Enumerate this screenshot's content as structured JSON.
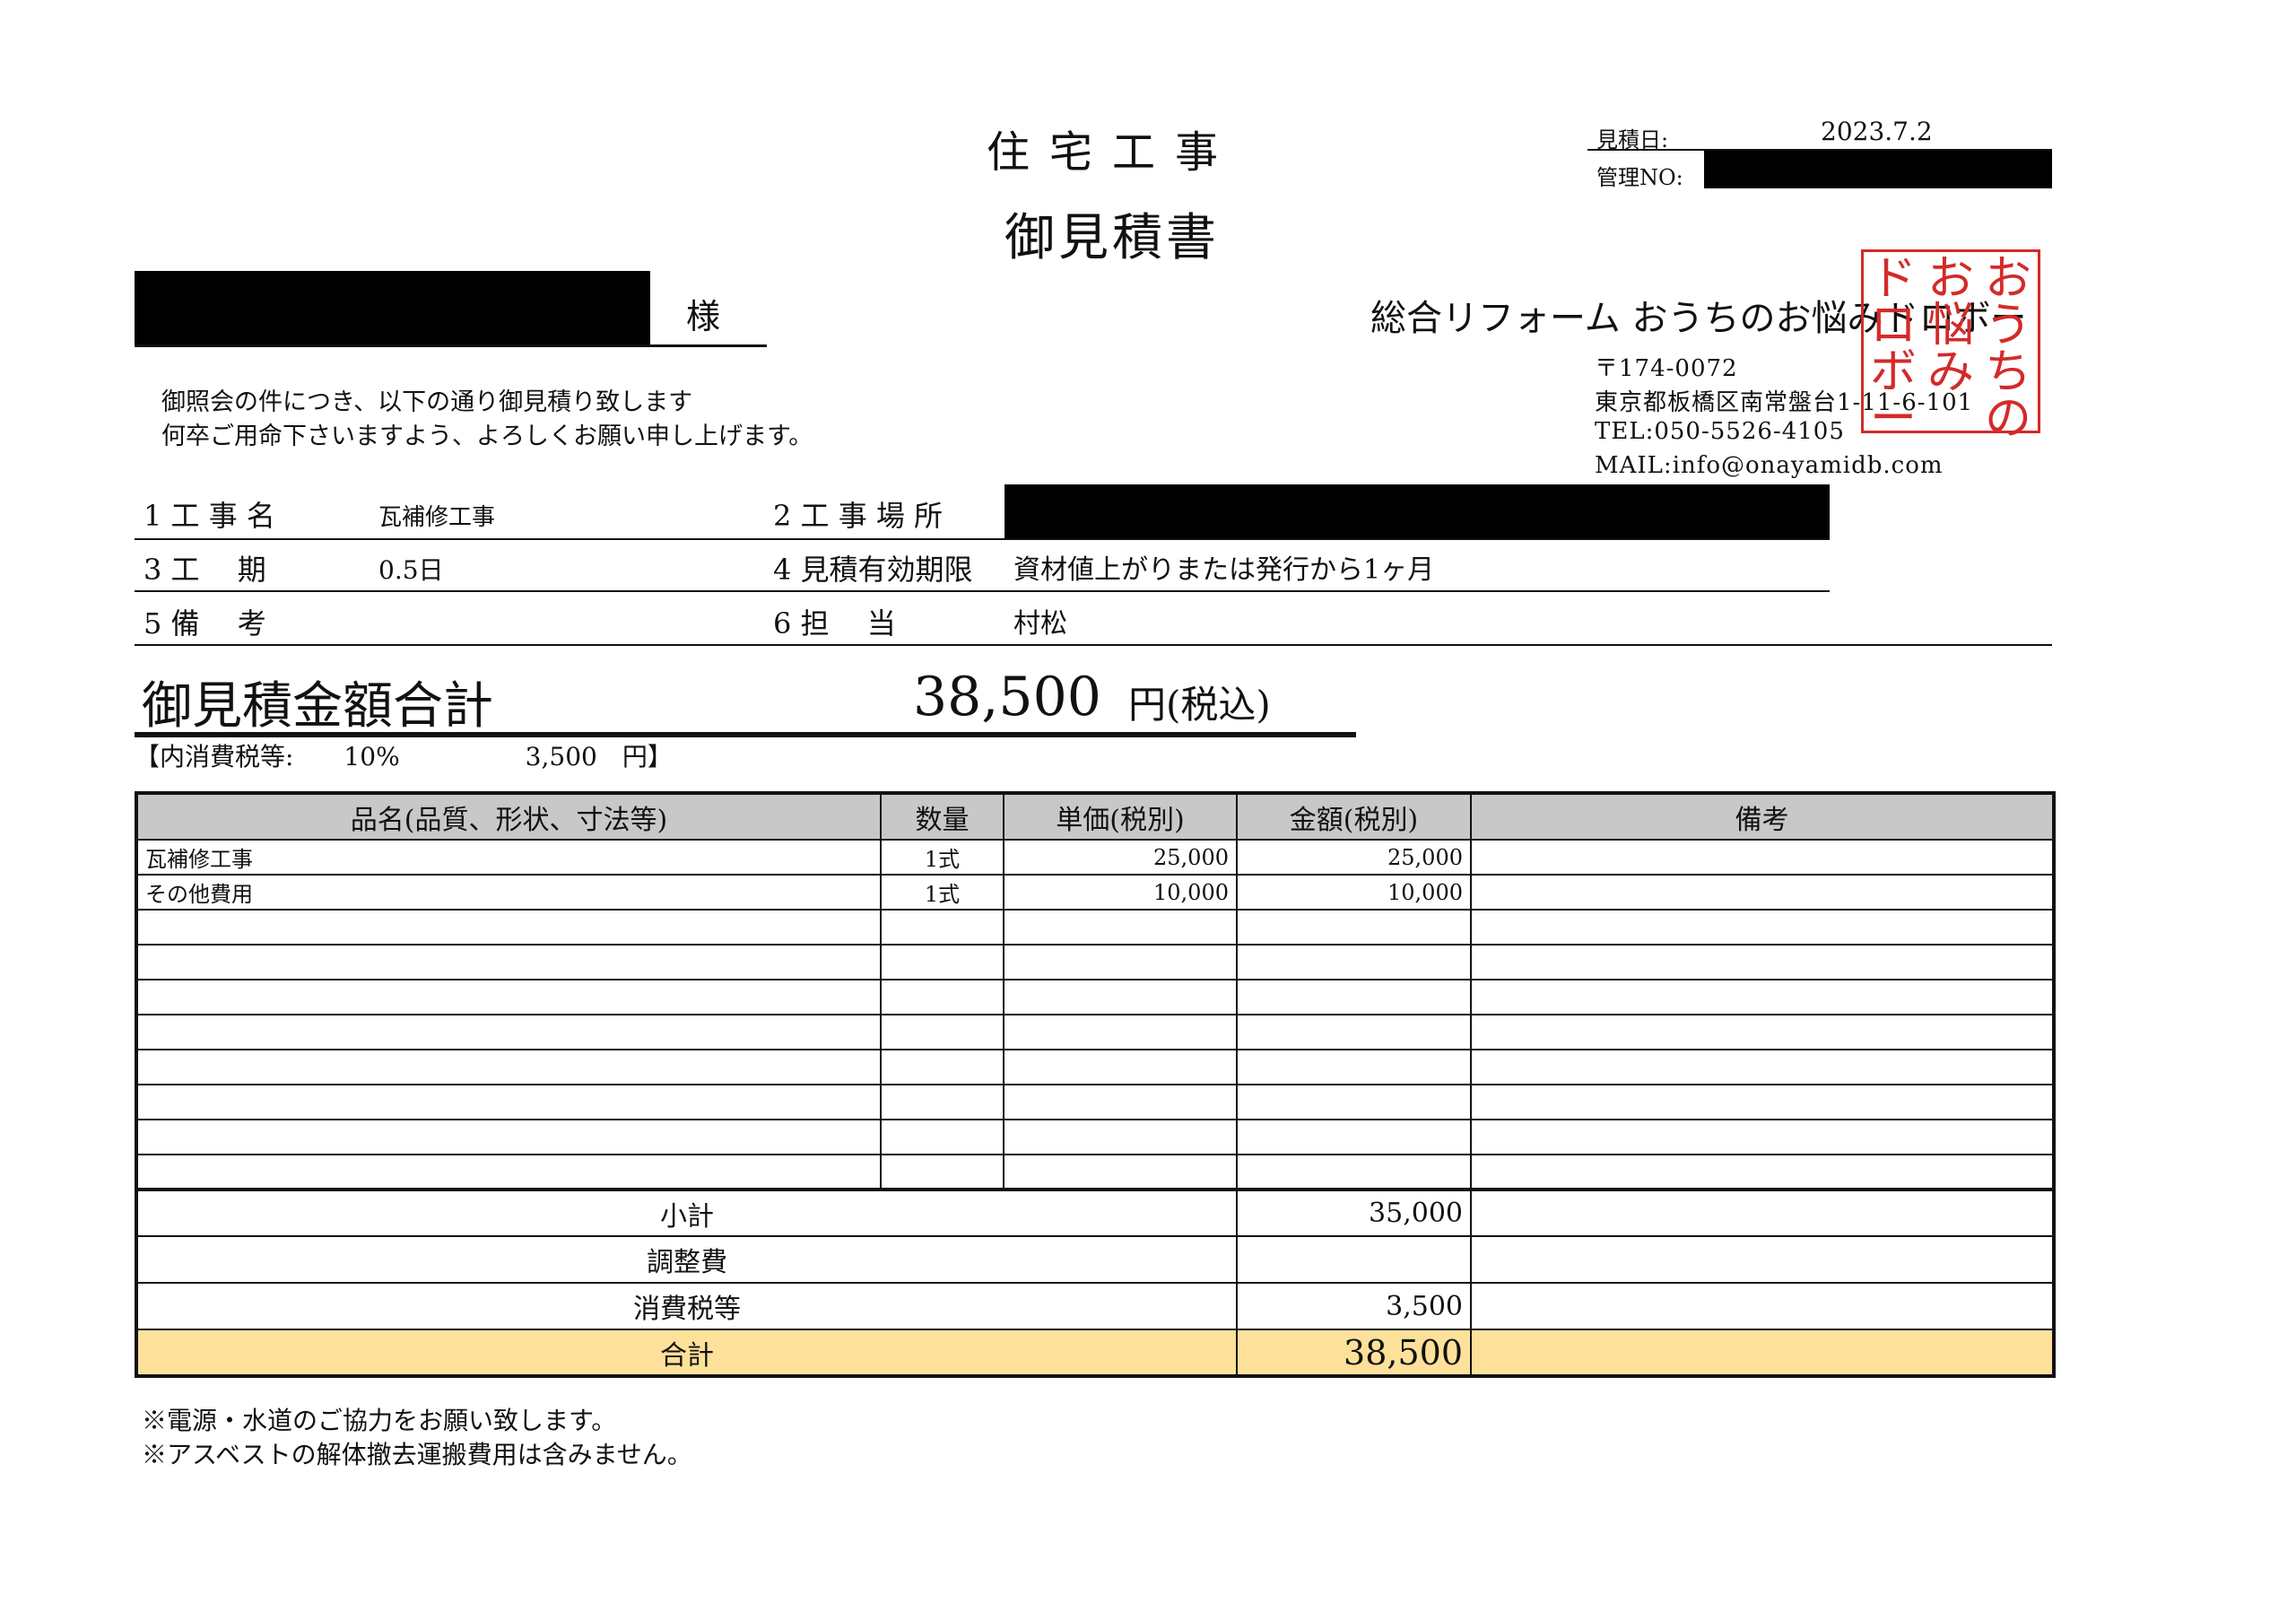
{
  "document": {
    "title_line1": "住宅工事",
    "title_line2": "御見積書"
  },
  "meta": {
    "date_label": "見積日:",
    "date_value": "2023.7.2",
    "mgmt_label": "管理NO:"
  },
  "customer": {
    "honorific": "様",
    "greeting_1": "御照会の件につき、以下の通り御見積り致します",
    "greeting_2": "何卒ご用命下さいますよう、よろしくお願い申し上げます。"
  },
  "company": {
    "name": "総合リフォーム おうちのお悩みドロボー",
    "postal": "〒174-0072",
    "address": "東京都板橋区南常盤台1-11-6-101",
    "tel": "TEL:050-5526-4105",
    "mail": "MAIL:info@onayamidb.com",
    "stamp_col_right": "おうちの",
    "stamp_col_mid": "お悩み",
    "stamp_col_left": "ドロボー"
  },
  "info": {
    "r1_label": "1 工 事 名",
    "r1_value": "瓦補修工事",
    "r1b_label": "2 工 事 場 所",
    "r2_label": "3 工　 期",
    "r2_value": "0.5日",
    "r2b_label": "4 見積有効期限",
    "r2b_value": "資材値上がりまたは発行から1ヶ月",
    "r3_label": "5 備　 考",
    "r3b_label": "6 担　 当",
    "r3b_value": "村松"
  },
  "total": {
    "label": "御見積金額合計",
    "value": "38,500",
    "unit": "円(税込)",
    "tax_note": "【内消費税等:　　10%　　　　　3,500　円】"
  },
  "table": {
    "headers": {
      "name": "品名(品質、形状、寸法等)",
      "qty": "数量",
      "unit_price": "単価(税別)",
      "amount": "金額(税別)",
      "remarks": "備考"
    },
    "rows": [
      {
        "name": "瓦補修工事",
        "qty": "1式",
        "unit_price": "25,000",
        "amount": "25,000",
        "remarks": ""
      },
      {
        "name": "その他費用",
        "qty": "1式",
        "unit_price": "10,000",
        "amount": "10,000",
        "remarks": ""
      },
      {
        "name": "",
        "qty": "",
        "unit_price": "",
        "amount": "",
        "remarks": ""
      },
      {
        "name": "",
        "qty": "",
        "unit_price": "",
        "amount": "",
        "remarks": ""
      },
      {
        "name": "",
        "qty": "",
        "unit_price": "",
        "amount": "",
        "remarks": ""
      },
      {
        "name": "",
        "qty": "",
        "unit_price": "",
        "amount": "",
        "remarks": ""
      },
      {
        "name": "",
        "qty": "",
        "unit_price": "",
        "amount": "",
        "remarks": ""
      },
      {
        "name": "",
        "qty": "",
        "unit_price": "",
        "amount": "",
        "remarks": ""
      },
      {
        "name": "",
        "qty": "",
        "unit_price": "",
        "amount": "",
        "remarks": ""
      },
      {
        "name": "",
        "qty": "",
        "unit_price": "",
        "amount": "",
        "remarks": ""
      }
    ],
    "subtotal_label": "小計",
    "subtotal_value": "35,000",
    "adjust_label": "調整費",
    "adjust_value": "",
    "tax_label": "消費税等",
    "tax_value": "3,500",
    "grand_label": "合計",
    "grand_value": "38,500"
  },
  "notes": {
    "n1": "※電源・水道のご協力をお願い致します。",
    "n2": "※アスベストの解体撤去運搬費用は含みません。"
  },
  "colors": {
    "stamp_red": "#d42a2a",
    "header_gray": "#c8c8c8",
    "grand_total_yellow": "#fde19a"
  }
}
